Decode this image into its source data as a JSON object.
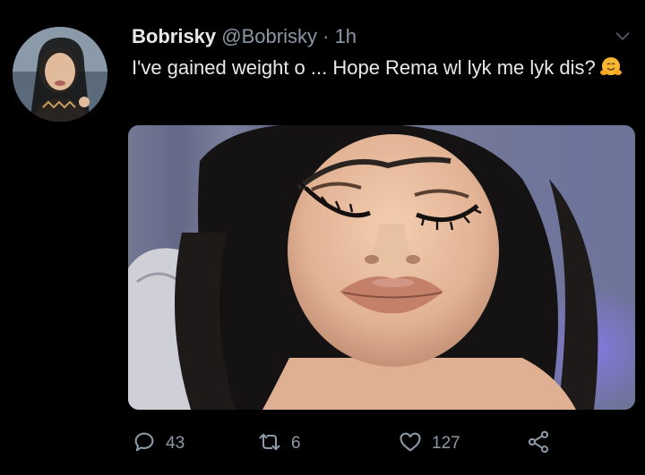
{
  "tweet": {
    "display_name": "Bobrisky",
    "handle": "@Bobrisky",
    "separator": "·",
    "time": "1h",
    "text": "I've gained weight o ... Hope Rema wl lyk me lyk dis?",
    "emoji": "hugging-face"
  },
  "actions": {
    "reply_count": "43",
    "retweet_count": "6",
    "like_count": "127"
  },
  "icons": {
    "reply": "reply-icon",
    "retweet": "retweet-icon",
    "like": "heart-icon",
    "share": "share-icon",
    "menu": "chevron-down-icon"
  },
  "colors": {
    "background": "#000000",
    "text": "#e7e9ea",
    "secondary_text": "#8b98a5",
    "emoji": "#f7b733"
  }
}
